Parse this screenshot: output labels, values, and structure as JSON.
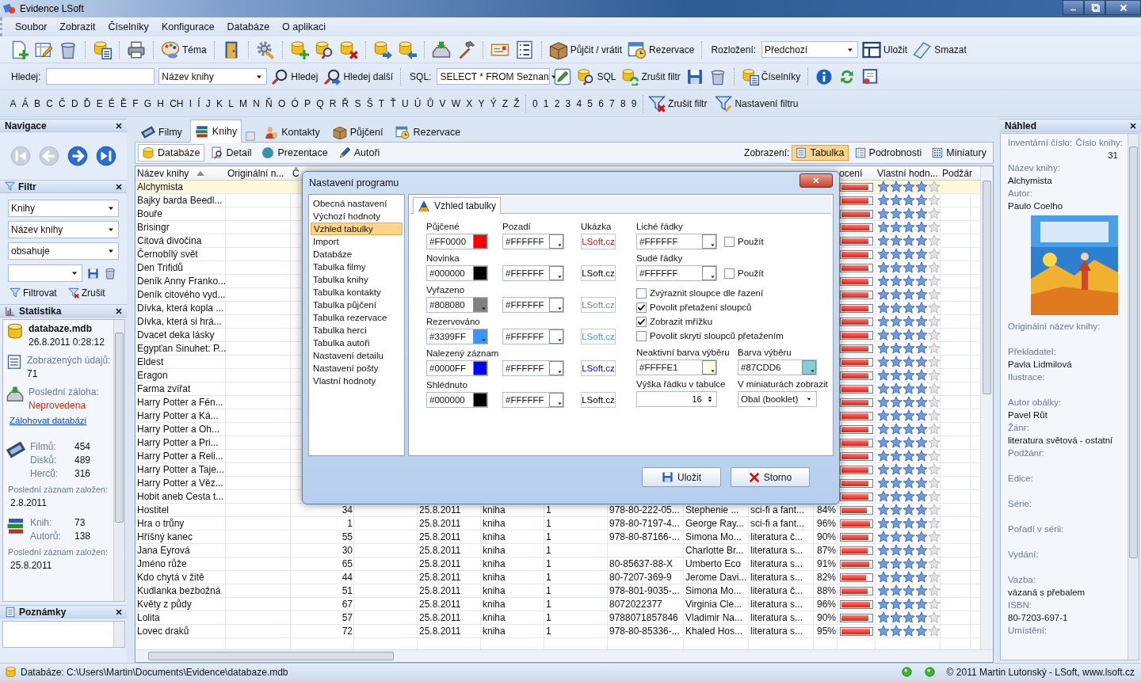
{
  "window": {
    "title": "Evidence LSoft"
  },
  "menu": [
    "Soubor",
    "Zobrazit",
    "Číselníky",
    "Konfigurace",
    "Databáze",
    "O aplikaci"
  ],
  "toolbar": {
    "labels": [
      "Téma",
      "Půjčit / vrátit",
      "Rezervace"
    ],
    "layout_label": "Rozložení:",
    "layout_value": "Předchozí",
    "layout_buttons": [
      "Uložit",
      "Smazat"
    ]
  },
  "search_bar": {
    "label": "Hledej:",
    "column": "Název knihy",
    "buttons": [
      "Hledej",
      "Hledej další"
    ],
    "sql_label": "SQL:",
    "sql_value": "SELECT * FROM Seznan",
    "sql_buttons": [
      "SQL",
      "Zrušit filtr"
    ],
    "catalog_button": "Číselníky"
  },
  "alphabet": {
    "letters": [
      "A",
      "Á",
      "B",
      "C",
      "Č",
      "D",
      "Ď",
      "E",
      "É",
      "Ě",
      "F",
      "G",
      "H",
      "CH",
      "I",
      "Í",
      "J",
      "K",
      "L",
      "M",
      "N",
      "Ň",
      "O",
      "Ó",
      "P",
      "Q",
      "R",
      "Ř",
      "S",
      "Š",
      "T",
      "Ť",
      "U",
      "Ú",
      "Ů",
      "V",
      "W",
      "X",
      "Y",
      "Ý",
      "Z",
      "Ž"
    ],
    "digits": [
      "0",
      "1",
      "2",
      "3",
      "4",
      "5",
      "6",
      "7",
      "8",
      "9"
    ],
    "buttons": [
      "Zrušit filtr",
      "Nastavení filtru"
    ]
  },
  "navigation": {
    "title": "Navigace",
    "buttons": [
      {
        "disabled": true
      },
      {
        "disabled": true
      },
      {
        "disabled": false
      },
      {
        "disabled": false
      }
    ]
  },
  "filter": {
    "title": "Filtr",
    "selects": [
      "Knihy",
      "Název knihy",
      "obsahuje"
    ],
    "buttons": [
      "Filtrovat",
      "Zrušit"
    ]
  },
  "statistics": {
    "title": "Statistika",
    "database": "databaze.mdb",
    "modified": "26.8.2011 0:28:12",
    "shown_label": "Zobrazených údajů:",
    "shown_value": "71",
    "backup_label": "Poslední záloha:",
    "backup_value": "Neprovedena",
    "backup_ok": false,
    "backup_link": "Zálohovat databázi",
    "groups": [
      {
        "counts": [
          {
            "label": "Filmů:",
            "value": "454"
          },
          {
            "label": "Disků:",
            "value": "489"
          },
          {
            "label": "Herců:",
            "value": "316"
          }
        ],
        "last_label": "Poslední záznam založen:",
        "last_value": "2.8.2011"
      },
      {
        "counts": [
          {
            "label": "Knih:",
            "value": "73"
          },
          {
            "label": "Autorů:",
            "value": "138"
          }
        ],
        "last_label": "Poslední záznam založen:",
        "last_value": "25.8.2011"
      }
    ]
  },
  "notes": {
    "title": "Poznámky"
  },
  "tabs": [
    {
      "label": "Filmy",
      "selected": false
    },
    {
      "label": "Knihy",
      "selected": true
    },
    {
      "label": "Kontakty",
      "selected": false
    },
    {
      "label": "Půjčení",
      "selected": false
    },
    {
      "label": "Rezervace",
      "selected": false
    }
  ],
  "subtabs": [
    {
      "label": "Databáze",
      "selected": true
    },
    {
      "label": "Detail",
      "selected": false
    },
    {
      "label": "Prezentace",
      "selected": false
    },
    {
      "label": "Autoři",
      "selected": false
    }
  ],
  "view_label": "Zobrazení:",
  "views": [
    {
      "label": "Tabulka",
      "selected": true
    },
    {
      "label": "Podrobnosti",
      "selected": false
    },
    {
      "label": "Miniatury",
      "selected": false
    }
  ],
  "table": {
    "columns": [
      {
        "label": "Název knihy",
        "sorted": true
      },
      {
        "label": "Originální n..."
      },
      {
        "label": "Č"
      },
      {
        "label": "ocení"
      },
      {
        "label": "Vlastní hodn..."
      },
      {
        "label": "Podžár"
      }
    ],
    "rows": [
      {
        "title": "Alchymista",
        "selected": true,
        "level": 0.9,
        "stars": 4
      },
      {
        "title": "Bajky barda Beedl...",
        "selected": false,
        "level": 0.9,
        "stars": 4
      },
      {
        "title": "Bouře",
        "selected": false,
        "level": 0.95,
        "stars": 4
      },
      {
        "title": "Brisingr",
        "selected": false,
        "level": 0.92,
        "stars": 4
      },
      {
        "title": "Citová divočina",
        "selected": false,
        "level": 0.9,
        "stars": 4
      },
      {
        "title": "Černobílý svět",
        "selected": false,
        "level": 0.9,
        "stars": 4
      },
      {
        "title": "Den Trifidů",
        "selected": false,
        "level": 0.9,
        "stars": 4
      },
      {
        "title": "Deník Anny Franko...",
        "selected": false,
        "level": 0.9,
        "stars": 4
      },
      {
        "title": "Deník citového vyd...",
        "selected": false,
        "level": 0.9,
        "stars": 4
      },
      {
        "title": "Dívka, která kopla ...",
        "selected": false,
        "level": 0.9,
        "stars": 4
      },
      {
        "title": "Dívka, která si hrá...",
        "selected": false,
        "level": 0.9,
        "stars": 4
      },
      {
        "title": "Dvacet deka lásky",
        "selected": false,
        "level": 0.9,
        "stars": 4
      },
      {
        "title": "Egypťan Sinuhet: P...",
        "selected": false,
        "level": 0.9,
        "stars": 4
      },
      {
        "title": "Eldest",
        "selected": false,
        "level": 0.9,
        "stars": 4
      },
      {
        "title": "Eragon",
        "selected": false,
        "level": 0.9,
        "stars": 4
      },
      {
        "title": "Farma zvířat",
        "selected": false,
        "level": 0.9,
        "stars": 4
      },
      {
        "title": "Harry Potter a Fén...",
        "selected": false,
        "level": 0.9,
        "stars": 4
      },
      {
        "title": "Harry Potter a Ká...",
        "selected": false,
        "level": 0.9,
        "stars": 4
      },
      {
        "title": "Harry Potter a Oh...",
        "selected": false,
        "level": 0.9,
        "stars": 4
      },
      {
        "title": "Harry Potter a Pri...",
        "selected": false,
        "level": 0.9,
        "stars": 4
      },
      {
        "title": "Harry Potter a Reli...",
        "selected": false,
        "level": 0.9,
        "stars": 4
      },
      {
        "title": "Harry Potter a Taje...",
        "selected": false,
        "level": 0.9,
        "stars": 4
      },
      {
        "title": "Harry Potter a Věz...",
        "selected": false,
        "level": 0.9,
        "stars": 4
      },
      {
        "title": "Hobit aneb Cesta t...",
        "selected": false,
        "level": 0.9,
        "stars": 4
      },
      {
        "title": "Hostitel",
        "number": "34",
        "date": "25.8.2011",
        "type": "kniha",
        "count": "1",
        "isbn": "978-80-222-05...",
        "author": "Stephenie ...",
        "genre": "sci-fi a fant...",
        "percent": "84%",
        "selected": false,
        "level": 0.84,
        "stars": 4
      },
      {
        "title": "Hra o trůny",
        "number": "1",
        "date": "25.8.2011",
        "type": "kniha",
        "count": "1",
        "isbn": "978-80-7197-4...",
        "author": "George Ray...",
        "genre": "sci-fi a fant...",
        "percent": "96%",
        "selected": false,
        "level": 0.96,
        "stars": 4
      },
      {
        "title": "Hříšný kanec",
        "number": "55",
        "date": "25.8.2011",
        "type": "kniha",
        "count": "1",
        "isbn": "978-80-87166-...",
        "author": "Simona Mo...",
        "genre": "literatura č...",
        "percent": "90%",
        "selected": false,
        "level": 0.9,
        "stars": 4
      },
      {
        "title": "Jana Eyrová",
        "number": "30",
        "date": "25.8.2011",
        "type": "kniha",
        "count": "1",
        "author": "Charlotte Br...",
        "genre": "literatura s...",
        "percent": "87%",
        "selected": false,
        "level": 0.87,
        "stars": 4
      },
      {
        "title": "Jméno růže",
        "number": "65",
        "date": "25.8.2011",
        "type": "kniha",
        "count": "1",
        "isbn": "80-85637-88-X",
        "author": "Umberto Eco",
        "genre": "literatura s...",
        "percent": "91%",
        "selected": false,
        "level": 0.91,
        "stars": 4
      },
      {
        "title": "Kdo chytá v žitě",
        "number": "44",
        "date": "25.8.2011",
        "type": "kniha",
        "count": "1",
        "isbn": "80-7207-369-9",
        "author": "Jerome Davi...",
        "genre": "literatura s...",
        "percent": "82%",
        "selected": false,
        "level": 0.82,
        "stars": 4
      },
      {
        "title": "Kudlanka bezbožná",
        "number": "51",
        "date": "25.8.2011",
        "type": "kniha",
        "count": "1",
        "isbn": "978-801-9035-...",
        "author": "Simona Mo...",
        "genre": "literatura č...",
        "percent": "88%",
        "selected": false,
        "level": 0.88,
        "stars": 4
      },
      {
        "title": "Květy z půdy",
        "number": "67",
        "date": "25.8.2011",
        "type": "kniha",
        "count": "1",
        "isbn": "8072022377",
        "author": "Virginia Cle...",
        "genre": "literatura s...",
        "percent": "96%",
        "selected": false,
        "level": 0.96,
        "stars": 4
      },
      {
        "title": "Lolita",
        "number": "57",
        "date": "25.8.2011",
        "type": "kniha",
        "count": "1",
        "isbn": "9788071857846",
        "author": "Vladimir Na...",
        "genre": "literatura s...",
        "percent": "90%",
        "selected": false,
        "level": 0.9,
        "stars": 4
      },
      {
        "title": "Lovec draků",
        "number": "72",
        "date": "25.8.2011",
        "type": "kniha",
        "count": "1",
        "isbn": "978-80-85336-...",
        "author": "Khaled Hos...",
        "genre": "literatura s...",
        "percent": "95%",
        "selected": false,
        "level": 0.95,
        "stars": 4
      }
    ]
  },
  "preview": {
    "title": "Náhled",
    "inventory_label": "Inventární číslo:",
    "number_label": "Číslo knihy:",
    "number_value": "31",
    "fields": [
      {
        "kind": "field",
        "label": "Název knihy:",
        "value": "Alchymista"
      },
      {
        "kind": "field",
        "label": "Autor:",
        "value": "Paulo Coelho"
      },
      {
        "kind": "picture"
      },
      {
        "kind": "field",
        "label": "Originální název knihy:"
      },
      {
        "kind": "field",
        "label": "Překladatel:",
        "value": "Pavla Lidmilová"
      },
      {
        "kind": "field",
        "label": "Ilustrace:"
      },
      {
        "kind": "field",
        "label": "Autor obálky:",
        "value": "Pavel Růt"
      },
      {
        "kind": "field",
        "label": "Žánr:",
        "value": "literatura světová - ostatní"
      },
      {
        "kind": "field",
        "label": "Podžánr:"
      },
      {
        "kind": "field",
        "label": "Edice:"
      },
      {
        "kind": "field",
        "label": "Série:"
      },
      {
        "kind": "field",
        "label": "Pořadí v sérii:"
      },
      {
        "kind": "field",
        "label": "Vydání:"
      },
      {
        "kind": "field",
        "label": "Vazba:",
        "value": "vázaná s přebalem"
      },
      {
        "kind": "field",
        "label": "ISBN:",
        "value": "80-7203-697-1"
      },
      {
        "kind": "field",
        "label": "Umístění:"
      }
    ]
  },
  "dialog": {
    "title": "Nastavení programu",
    "sections": [
      {
        "label": "Obecná nastavení",
        "selected": false
      },
      {
        "label": "Výchozí hodnoty",
        "selected": false
      },
      {
        "label": "Vzhled tabulky",
        "selected": true
      },
      {
        "label": "Import",
        "selected": false
      },
      {
        "label": "Databáze",
        "selected": false
      },
      {
        "label": "Tabulka filmy",
        "selected": false
      },
      {
        "label": "Tabulka knihy",
        "selected": false
      },
      {
        "label": "Tabulka kontakty",
        "selected": false
      },
      {
        "label": "Tabulka půjčení",
        "selected": false
      },
      {
        "label": "Tabulka rezervace",
        "selected": false
      },
      {
        "label": "Tabulka herci",
        "selected": false
      },
      {
        "label": "Tabulka autoři",
        "selected": false
      },
      {
        "label": "Nastavení detailu",
        "selected": false
      },
      {
        "label": "Nastavení pošty",
        "selected": false
      },
      {
        "label": "Vlastní hodnoty",
        "selected": false
      }
    ],
    "tab": "Vzhled tabulky",
    "background_header": "Pozadí",
    "sample_header": "Ukázka",
    "color_rows": [
      {
        "label": "Půjčené",
        "value": "#FF0000",
        "color": "#ff0000",
        "background": "#FFFFFF",
        "sample": "LSoft.cz"
      },
      {
        "label": "Novinka",
        "value": "#000000",
        "color": "#000000",
        "background": "#FFFFFF",
        "sample": "LSoft.cz"
      },
      {
        "label": "Vyřazeno",
        "value": "#808080",
        "color": "#808080",
        "background": "#FFFFFF",
        "sample": "LSoft.cz"
      },
      {
        "label": "Rezervováno",
        "value": "#3399FF",
        "color": "#3399ff",
        "background": "#FFFFFF",
        "sample": "LSoft.cz"
      },
      {
        "label": "Nalezený záznam",
        "value": "#0000FF",
        "color": "#0000ff",
        "background": "#FFFFFF",
        "sample": "LSoft.cz"
      },
      {
        "label": "Shlédnuto",
        "value": "#000000",
        "color": "#000000",
        "background": "#FFFFFF",
        "sample": "LSoft.cz"
      }
    ],
    "row_colors": [
      {
        "label": "Liché řádky",
        "value": "#FFFFFF",
        "color": "#ffffff",
        "use_label": "Použít",
        "use": false
      },
      {
        "label": "Sudé řádky",
        "value": "#FFFFFF",
        "color": "#ffffff",
        "use_label": "Použít",
        "use": false
      }
    ],
    "options": [
      {
        "label": "Zvýraznit sloupce dle řazení",
        "checked": false
      },
      {
        "label": "Povolit přetažení sloupců",
        "checked": true
      },
      {
        "label": "Zobrazit mřížku",
        "checked": true
      },
      {
        "label": "Povolit skrytí sloupců přetažením",
        "checked": false
      }
    ],
    "inactive_selection": {
      "label": "Neaktivní barva výběru",
      "value": "#FFFFE1",
      "color": "#ffffe1"
    },
    "selection": {
      "label": "Barva výběru",
      "value": "#87CDD6",
      "color": "#87cdd6"
    },
    "row_height": {
      "label": "Výška řádku v tabulce",
      "value": "16"
    },
    "thumbnails": {
      "label": "V miniaturách zobrazit",
      "value": "Obal (booklet)"
    },
    "buttons": [
      "Uložit",
      "Storno"
    ]
  },
  "status_bar": {
    "path": "Databáze: C:\\Users\\Martin\\Documents\\Evidence\\databaze.mdb",
    "copyright": "© 2011 Martin Lutonský - LSoft, www.lsoft.cz"
  }
}
